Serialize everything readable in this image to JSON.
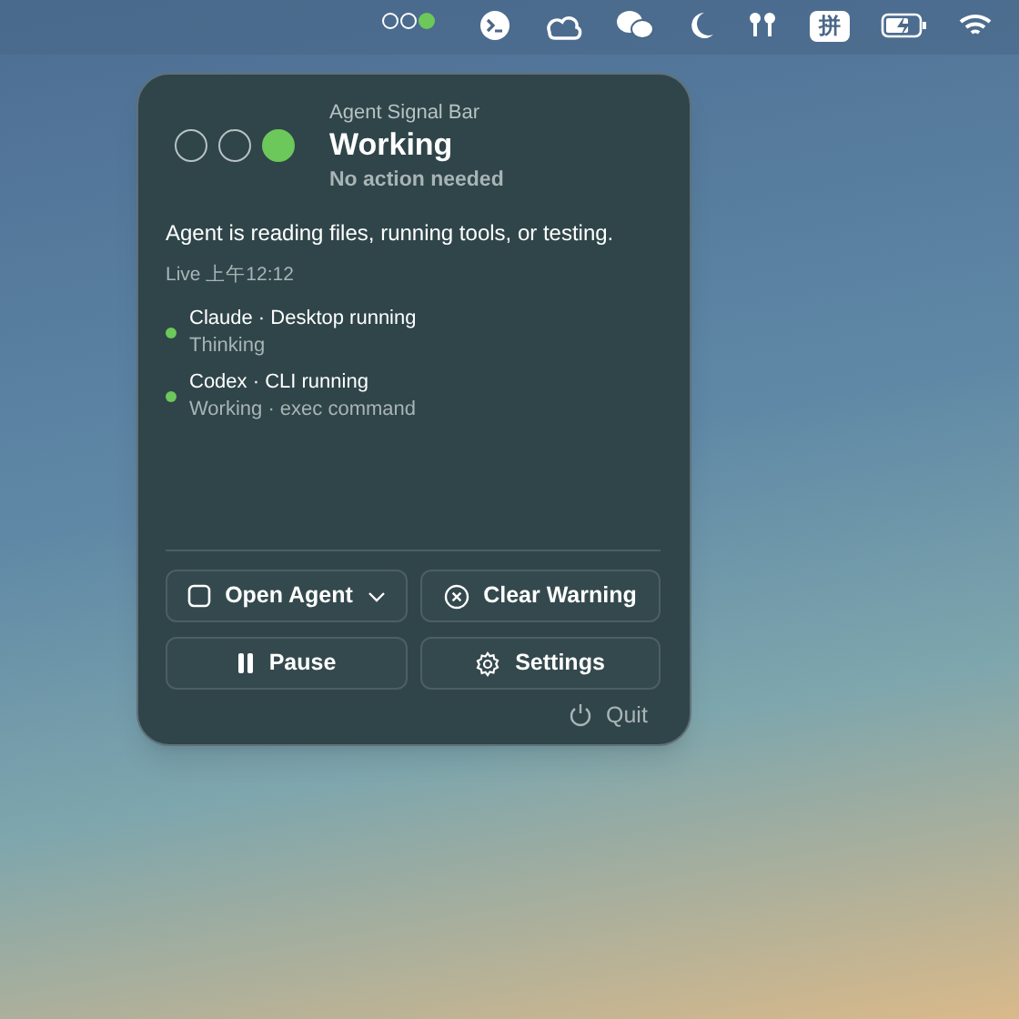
{
  "menu_bar": {
    "signal_lights": [
      {
        "on": false
      },
      {
        "on": false
      },
      {
        "on": true
      }
    ],
    "input_method": "拼"
  },
  "popup": {
    "lights": [
      {
        "on": false
      },
      {
        "on": false
      },
      {
        "on": true
      }
    ],
    "app_name": "Agent Signal Bar",
    "status": "Working",
    "subtitle": "No action needed",
    "description": "Agent is reading files, running tools, or testing.",
    "live": "Live 上午12:12",
    "agents": [
      {
        "title": "Claude · Desktop running",
        "detail": "Thinking",
        "color": "#6cc85a"
      },
      {
        "title": "Codex · CLI running",
        "detail": "Working · exec command",
        "color": "#6cc85a"
      }
    ],
    "buttons": [
      {
        "kind": "open",
        "label": "Open Agent"
      },
      {
        "kind": "clear",
        "label": "Clear Warning"
      },
      {
        "kind": "pause",
        "label": "Pause"
      },
      {
        "kind": "settings",
        "label": "Settings"
      }
    ],
    "quit": "Quit"
  }
}
